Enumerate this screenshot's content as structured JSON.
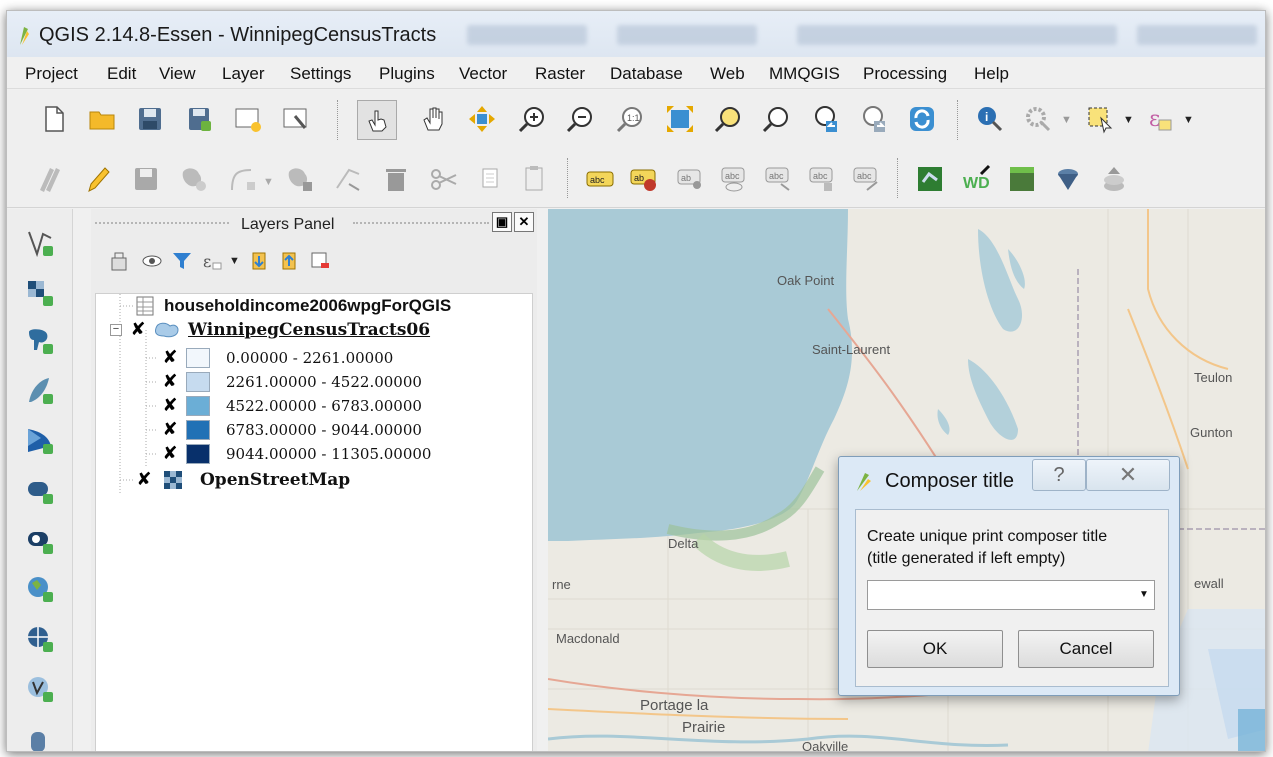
{
  "window": {
    "title": "QGIS 2.14.8-Essen - WinnipegCensusTracts"
  },
  "menubar": {
    "items": [
      "Project",
      "Edit",
      "View",
      "Layer",
      "Settings",
      "Plugins",
      "Vector",
      "Raster",
      "Database",
      "Web",
      "MMQGIS",
      "Processing",
      "Help"
    ]
  },
  "layers_panel": {
    "title": "Layers Panel",
    "layers": [
      {
        "name": "householdincome2006wpgForQGIS"
      },
      {
        "name": "WinnipegCensusTracts06",
        "classes": [
          {
            "label": "0.00000 - 2261.00000",
            "color": "#f2f7fc"
          },
          {
            "label": "2261.00000 - 4522.00000",
            "color": "#c6dbef"
          },
          {
            "label": "4522.00000 - 6783.00000",
            "color": "#6baed6"
          },
          {
            "label": "6783.00000 - 9044.00000",
            "color": "#2171b5"
          },
          {
            "label": "9044.00000 - 11305.00000",
            "color": "#08306b"
          }
        ]
      },
      {
        "name": "OpenStreetMap"
      }
    ]
  },
  "map": {
    "labels": {
      "oak_point": "Oak Point",
      "saint_laurent": "Saint-Laurent",
      "teulon": "Teulon",
      "gunton": "Gunton",
      "delta": "Delta",
      "rne": "rne",
      "macdonald": "Macdonald",
      "portage": "Portage la",
      "prairie": "Prairie",
      "oakville": "Oakville",
      "ewall": "ewall"
    }
  },
  "dialog": {
    "title": "Composer title",
    "help_label": "?",
    "close_label": "✕",
    "message_line1": "Create unique print composer title",
    "message_line2": "(title generated if left empty)",
    "input_value": "",
    "ok_label": "OK",
    "cancel_label": "Cancel"
  }
}
